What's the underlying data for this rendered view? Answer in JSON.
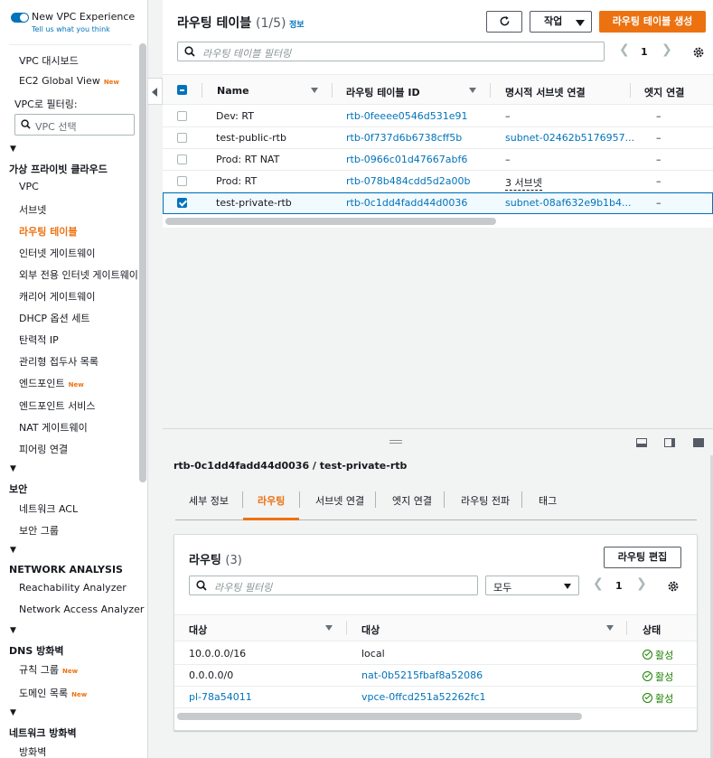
{
  "sidebar": {
    "toggle_title": "New VPC Experience",
    "toggle_sub": "Tell us what you think",
    "items_top": [
      "VPC 대시보드",
      "EC2 Global View"
    ],
    "new_badge": "New",
    "filter_label": "VPC로 필터링:",
    "filter_placeholder": "VPC 선택",
    "sections": {
      "vpc": "가상 프라이빗 클라우드",
      "security": "보안",
      "network_analysis": "NETWORK ANALYSIS",
      "dns_firewall": "DNS 방화벽",
      "network_firewall": "네트워크 방화벽"
    },
    "vpc_items": [
      "VPC",
      "서브넷",
      "라우팅 테이블",
      "인터넷 게이트웨이",
      "외부 전용 인터넷 게이트웨이",
      "캐리어 게이트웨이",
      "DHCP 옵션 세트",
      "탄력적 IP",
      "관리형 접두사 목록",
      "엔드포인트",
      "엔드포인트 서비스",
      "NAT 게이트웨이",
      "피어링 연결"
    ],
    "security_items": [
      "네트워크 ACL",
      "보안 그룹"
    ],
    "analysis_items": [
      "Reachability Analyzer",
      "Network Access Analyzer"
    ],
    "dns_items": [
      "규칙 그룹",
      "도메인 목록"
    ],
    "firewall_items": [
      "방화벽"
    ]
  },
  "top": {
    "title": "라우팅 테이블",
    "count": "(1/5)",
    "info": "정보",
    "actions_label": "작업",
    "create_label": "라우팅 테이블 생성",
    "filter_placeholder": "라우팅 테이블 필터링",
    "page": "1",
    "columns": [
      "Name",
      "라우팅 테이블 ID",
      "명시적 서브넷 연결",
      "엣지 연결"
    ],
    "rows": [
      {
        "name": "Dev: RT",
        "id": "rtb-0feeee0546d531e91",
        "subnet": "–",
        "edge": "–",
        "selected": false
      },
      {
        "name": "test-public-rtb",
        "id": "rtb-0f737d6b6738cff5b",
        "subnet": "subnet-02462b5176957...",
        "edge": "–",
        "selected": false
      },
      {
        "name": "Prod: RT NAT",
        "id": "rtb-0966c01d47667abf6",
        "subnet": "–",
        "edge": "–",
        "selected": false
      },
      {
        "name": "Prod: RT",
        "id": "rtb-078b484cdd5d2a00b",
        "subnet": "3 서브넷",
        "edge": "–",
        "selected": false
      },
      {
        "name": "test-private-rtb",
        "id": "rtb-0c1dd4fadd44d0036",
        "subnet": "subnet-08af632e9b1b4...",
        "edge": "–",
        "selected": true
      }
    ]
  },
  "detail": {
    "title": "rtb-0c1dd4fadd44d0036 / test-private-rtb",
    "tabs": [
      "세부 정보",
      "라우팅",
      "서브넷 연결",
      "엣지 연결",
      "라우팅 전파",
      "태그"
    ],
    "active_tab": "라우팅",
    "card_title": "라우팅",
    "card_count": "(3)",
    "edit_label": "라우팅 편집",
    "filter_placeholder": "라우팅 필터링",
    "select_value": "모두",
    "page": "1",
    "columns": [
      "대상",
      "대상",
      "상태"
    ],
    "routes": [
      {
        "destination": "10.0.0.0/16",
        "target": "local",
        "status": "활성",
        "dest_link": false,
        "target_link": false
      },
      {
        "destination": "0.0.0.0/0",
        "target": "nat-0b5215fbaf8a52086",
        "status": "활성",
        "dest_link": false,
        "target_link": true
      },
      {
        "destination": "pl-78a54011",
        "target": "vpce-0ffcd251a52262fc1",
        "status": "활성",
        "dest_link": true,
        "target_link": true
      }
    ]
  },
  "colors": {
    "accent": "#ec7211",
    "link": "#0073bb",
    "success": "#1d8102"
  }
}
